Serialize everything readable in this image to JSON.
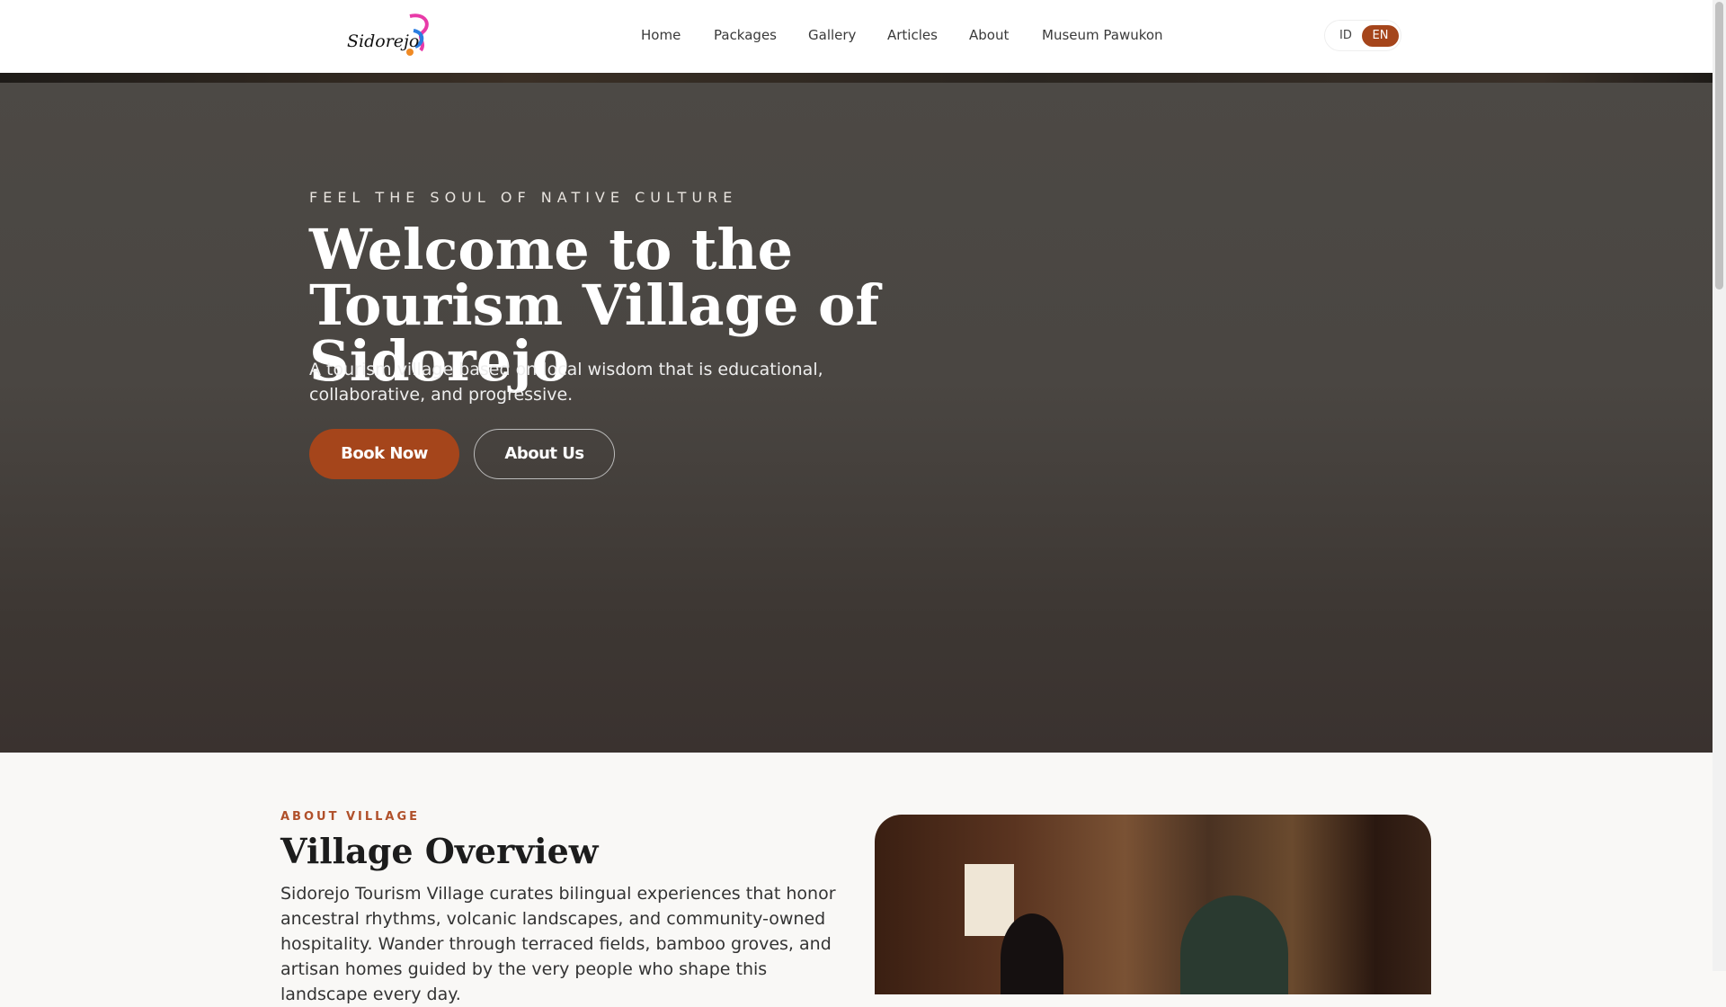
{
  "header": {
    "logo_text": "Sidorejo",
    "nav": [
      "Home",
      "Packages",
      "Gallery",
      "Articles",
      "About",
      "Museum Pawukon"
    ],
    "lang": {
      "id": "ID",
      "en": "EN",
      "active": "EN"
    }
  },
  "hero": {
    "eyebrow": "FEEL THE SOUL OF NATIVE CULTURE",
    "title": "Welcome to the Tourism Village of Sidorejo",
    "description": "A tourism village based on local wisdom that is educational, collaborative, and progressive.",
    "book_now": "Book Now",
    "about_us": "About Us"
  },
  "about": {
    "label": "ABOUT VILLAGE",
    "title": "Village Overview",
    "text": "Sidorejo Tourism Village curates bilingual experiences that honor ancestral rhythms, volcanic landscapes, and community-owned hospitality. Wander through terraced fields, bamboo groves, and artisan homes guided by the very people who shape this landscape every day."
  },
  "colors": {
    "accent": "#a5451b"
  }
}
